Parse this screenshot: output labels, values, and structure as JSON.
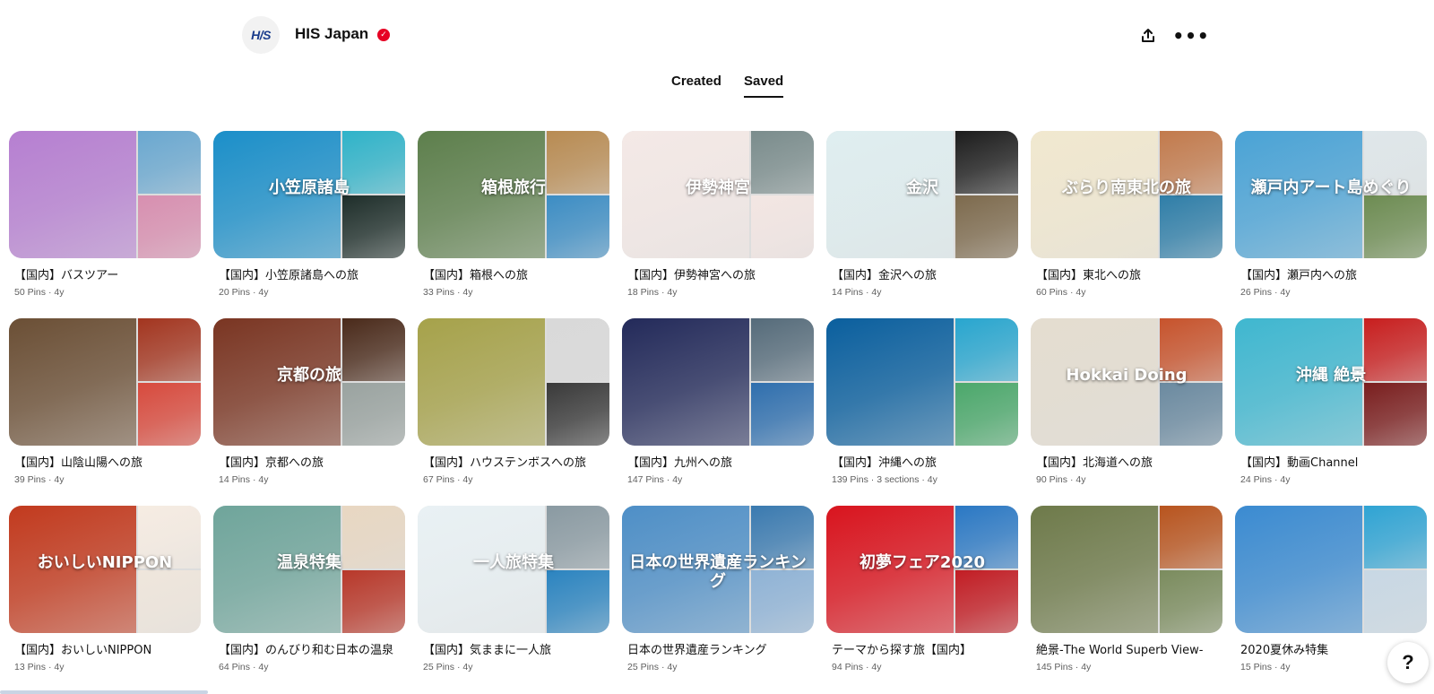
{
  "profile": {
    "avatar_text": "H/S",
    "name": "HIS Japan",
    "verified_icon": "verified-check-icon",
    "share_icon": "share-icon",
    "more_icon": "more-options-icon",
    "more_glyph": "•••",
    "share_glyph": "⇪"
  },
  "tabs": [
    {
      "label": "Created"
    },
    {
      "label": "Saved"
    }
  ],
  "boards": [
    {
      "title": "【国内】バスツアー",
      "meta": "50 Pins · 4y",
      "caption": "",
      "colors": [
        "#b67fd1",
        "#6aa8d0",
        "#d88fb0"
      ]
    },
    {
      "title": "【国内】小笠原諸島への旅",
      "meta": "20 Pins · 4y",
      "caption": "小笠原諸島",
      "colors": [
        "#1b8fc9",
        "#2fb3c9",
        "#1e2e2a"
      ]
    },
    {
      "title": "【国内】箱根への旅",
      "meta": "33 Pins · 4y",
      "caption": "箱根旅行",
      "colors": [
        "#5d7f4c",
        "#b88b52",
        "#3c8dc4"
      ]
    },
    {
      "title": "【国内】伊勢神宮への旅",
      "meta": "18 Pins · 4y",
      "caption": "伊勢神宮",
      "colors": [
        "#f4e9e6",
        "#7a8c8c",
        "#f3e6e3"
      ]
    },
    {
      "title": "【国内】金沢への旅",
      "meta": "14 Pins · 4y",
      "caption": "金沢",
      "colors": [
        "#dfeef0",
        "#1c1c1c",
        "#7d6a4d"
      ]
    },
    {
      "title": "【国内】東北への旅",
      "meta": "60 Pins · 4y",
      "caption": "ぶらり南東北の旅",
      "colors": [
        "#f1e8cf",
        "#c27a4c",
        "#2f7ea8"
      ]
    },
    {
      "title": "【国内】瀬戸内への旅",
      "meta": "26 Pins · 4y",
      "caption": "瀬戸内アート島めぐり",
      "colors": [
        "#4aa3d6",
        "#dfe7ea",
        "#6d8c52"
      ]
    },
    {
      "title": "【国内】山陰山陽への旅",
      "meta": "39 Pins · 4y",
      "caption": "",
      "colors": [
        "#6b4f35",
        "#a3351f",
        "#d84a3d"
      ]
    },
    {
      "title": "【国内】京都への旅",
      "meta": "14 Pins · 4y",
      "caption": "京都の旅",
      "colors": [
        "#7a3522",
        "#4a2a1a",
        "#9aa3a0"
      ]
    },
    {
      "title": "【国内】ハウステンボスへの旅",
      "meta": "67 Pins · 4y",
      "caption": "",
      "colors": [
        "#a6a24a",
        "#d9d9d9",
        "#3a3a3a"
      ]
    },
    {
      "title": "【国内】九州への旅",
      "meta": "147 Pins · 4y",
      "caption": "",
      "colors": [
        "#232a5a",
        "#556b7a",
        "#2f6fae"
      ]
    },
    {
      "title": "【国内】沖縄への旅",
      "meta": "139 Pins · 3 sections · 4y",
      "caption": "",
      "colors": [
        "#0a5f9e",
        "#28a6cf",
        "#4ba86b"
      ]
    },
    {
      "title": "【国内】北海道への旅",
      "meta": "90 Pins · 4y",
      "caption": "Hokkai Doing",
      "colors": [
        "#e4ddd0",
        "#c7532c",
        "#6b8aa0"
      ]
    },
    {
      "title": "【国内】動画Channel",
      "meta": "24 Pins · 4y",
      "caption": "沖縄 絶景",
      "colors": [
        "#3fb7d0",
        "#c81e1e",
        "#7a1e1e"
      ]
    },
    {
      "title": "【国内】おいしいNIPPON",
      "meta": "13 Pins · 4y",
      "caption": "おいしいNIPPON",
      "colors": [
        "#c23a1e",
        "#f6ece2",
        "#efe6dc"
      ]
    },
    {
      "title": "【国内】のんびり和む日本の温泉",
      "meta": "64 Pins · 4y",
      "caption": "温泉特集",
      "colors": [
        "#6fa59b",
        "#e8d7c2",
        "#b8382a"
      ]
    },
    {
      "title": "【国内】気ままに一人旅",
      "meta": "25 Pins · 4y",
      "caption": "一人旅特集",
      "colors": [
        "#e9f1f4",
        "#8a9aa2",
        "#2b84c0"
      ]
    },
    {
      "title": "日本の世界遺産ランキング",
      "meta": "25 Pins · 4y",
      "caption": "日本の世界遺産ランキング",
      "colors": [
        "#4e8fc7",
        "#3a7ab0",
        "#8fb3d6"
      ]
    },
    {
      "title": "テーマから探す旅【国内】",
      "meta": "94 Pins · 4y",
      "caption": "初夢フェア2020",
      "colors": [
        "#d9141e",
        "#2a78c4",
        "#c21d24"
      ]
    },
    {
      "title": "絶景-The World Superb View-",
      "meta": "145 Pins · 4y",
      "caption": "",
      "colors": [
        "#6e7a4a",
        "#b8541e",
        "#7b8c5e"
      ]
    },
    {
      "title": "2020夏休み特集",
      "meta": "15 Pins · 4y",
      "caption": "",
      "colors": [
        "#3b8bd1",
        "#2fa4d4",
        "#c8d8e4"
      ]
    }
  ],
  "help": {
    "label": "?"
  }
}
